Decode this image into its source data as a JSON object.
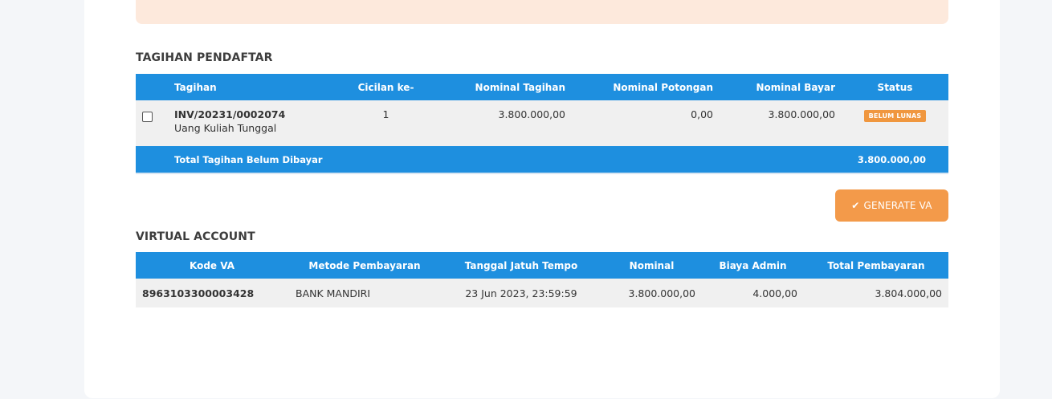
{
  "colors": {
    "accent": "#1e8fdf",
    "warning": "#f0973f",
    "alert_bg": "#fde9dc"
  },
  "tagihan": {
    "title": "TAGIHAN PENDAFTAR",
    "headers": [
      "Tagihan",
      "Cicilan ke-",
      "Nominal Tagihan",
      "Nominal Potongan",
      "Nominal Bayar",
      "Status"
    ],
    "rows": [
      {
        "invoice": "INV/20231/0002074",
        "description": "Uang Kuliah Tunggal",
        "cicilan": "1",
        "nominal_tagihan": "3.800.000,00",
        "nominal_potongan": "0,00",
        "nominal_bayar": "3.800.000,00",
        "status": "BELUM LUNAS"
      }
    ],
    "total_label": "Total Tagihan Belum Dibayar",
    "total_value": "3.800.000,00"
  },
  "generate_va_label": "GENERATE VA",
  "virtual_account": {
    "title": "VIRTUAL ACCOUNT",
    "headers": [
      "Kode VA",
      "Metode Pembayaran",
      "Tanggal Jatuh Tempo",
      "Nominal",
      "Biaya Admin",
      "Total Pembayaran"
    ],
    "rows": [
      {
        "kode": "8963103300003428",
        "metode": "BANK MANDIRI",
        "jatuh_tempo": "23 Jun 2023, 23:59:59",
        "nominal": "3.800.000,00",
        "biaya_admin": "4.000,00",
        "total": "3.804.000,00"
      }
    ]
  }
}
